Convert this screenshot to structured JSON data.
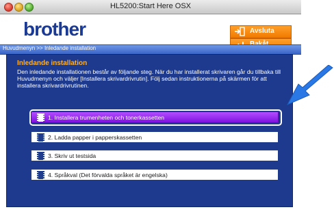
{
  "window": {
    "title": "HL5200:Start Here OSX"
  },
  "header": {
    "brand": "brother",
    "exit_label": "Avsluta",
    "back_label": "Bakåt"
  },
  "breadcrumb": {
    "home": "Huvudmenyn",
    "sep": ">>",
    "current": "Inledande installation"
  },
  "main": {
    "title": "Inledande installation",
    "description": "Den inledande installationen består av följande steg. När du har installerat skrivaren går du tillbaka till Huvudmenyn och väljer [Installera skrivardrivrutin]. Följ sedan instruktionerna på skärmen för att installera skrivardrivrutinen.",
    "steps": [
      {
        "label": "1. Installera trumenheten och tonerkassetten"
      },
      {
        "label": "2. Ladda papper i papperskassetten"
      },
      {
        "label": "3. Skriv ut testsida"
      },
      {
        "label": "4. Språkval (Det förvalda språket är engelska)"
      }
    ]
  },
  "colors": {
    "panel": "#1d3a8e",
    "accent_orange": "#f07a00",
    "highlight_purple": "#8f1ff0",
    "pointer_blue": "#2a78e6"
  },
  "icons": [
    "traffic-close-icon",
    "traffic-minimize-icon",
    "traffic-zoom-icon",
    "exit-icon",
    "back-icon",
    "film-strip-icon",
    "pointer-arrow-icon"
  ]
}
